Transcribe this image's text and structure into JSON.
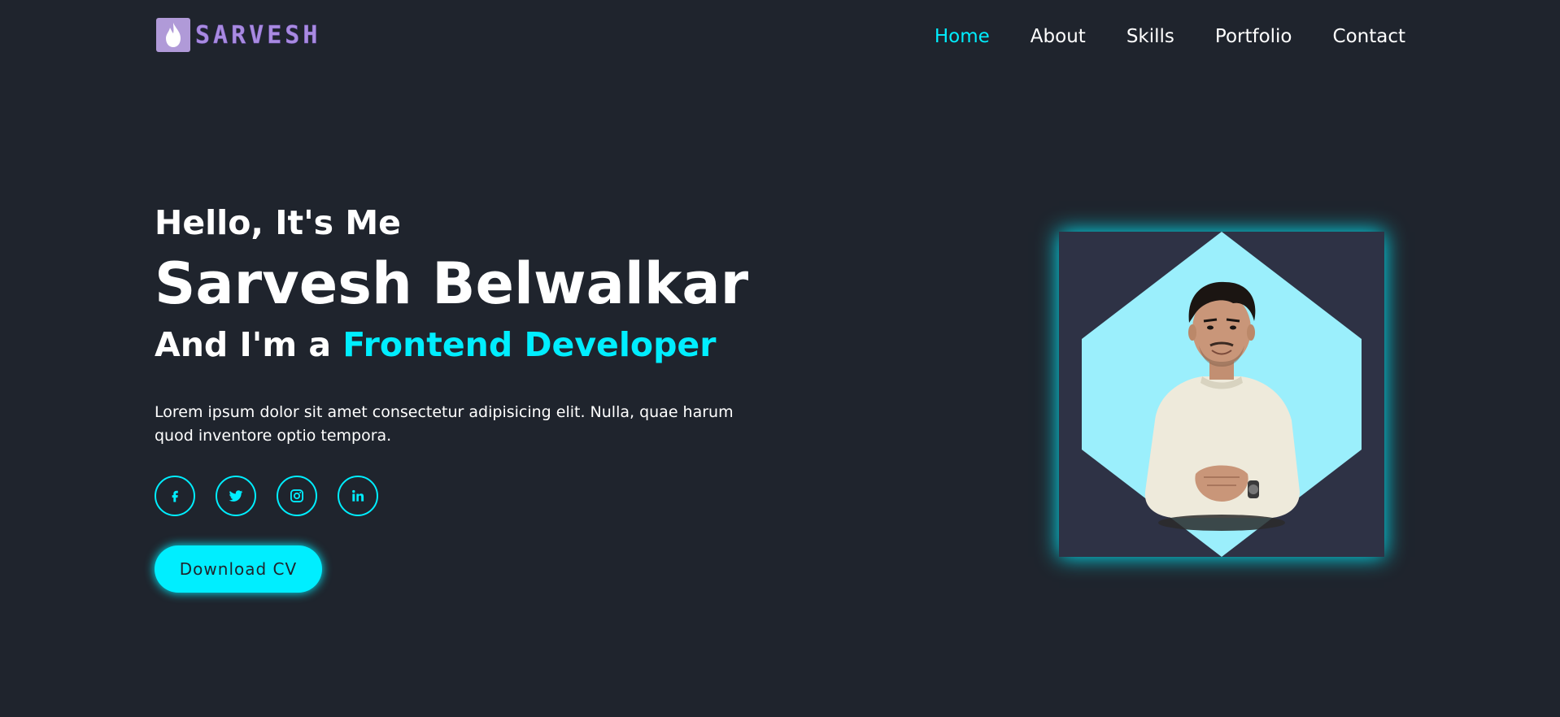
{
  "header": {
    "logo_text": "SARVESH",
    "nav": [
      {
        "label": "Home",
        "active": true
      },
      {
        "label": "About",
        "active": false
      },
      {
        "label": "Skills",
        "active": false
      },
      {
        "label": "Portfolio",
        "active": false
      },
      {
        "label": "Contact",
        "active": false
      }
    ]
  },
  "hero": {
    "greeting": "Hello, It's Me",
    "name": "Sarvesh Belwalkar",
    "role_prefix": "And I'm a ",
    "role_highlight": "Frontend Developer",
    "description": "Lorem ipsum dolor sit amet consectetur adipisicing elit. Nulla, quae harum quod inventore optio tempora.",
    "socials": [
      "facebook-icon",
      "twitter-icon",
      "instagram-icon",
      "linkedin-icon"
    ],
    "cv_button": "Download CV"
  },
  "colors": {
    "background": "#1f242d",
    "accent": "#00eeff",
    "logo": "#a98be0",
    "card_bg": "#2e3245",
    "hexagon": "#9beffc"
  }
}
